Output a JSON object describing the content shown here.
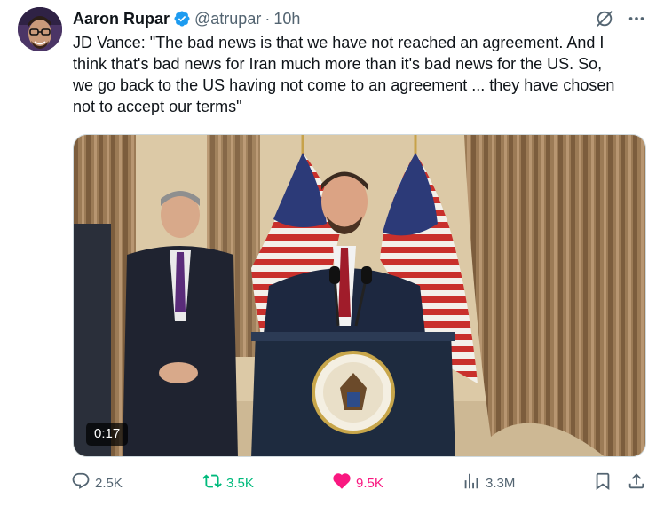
{
  "author": {
    "name": "Aaron Rupar",
    "handle": "@atrupar",
    "separator": "·",
    "time": "10h",
    "verified": true
  },
  "icons": {
    "verified": "verified-badge-icon",
    "grok": "grok-icon",
    "more": "more-options-icon",
    "reply": "reply-icon",
    "repost": "repost-icon",
    "like": "heart-icon",
    "views": "views-icon",
    "bookmark": "bookmark-icon",
    "share": "share-icon"
  },
  "tweet": {
    "text": "JD Vance: \"The bad news is that we have not reached an agreement. And I\nthink that's bad news for Iran much more than it's bad news for the US. So,\nwe go back to the US having not come to an agreement ... they have chosen\nnot to accept our terms\""
  },
  "media": {
    "type": "video",
    "duration": "0:17"
  },
  "actions": {
    "reply_count": "2.5K",
    "repost_count": "3.5K",
    "like_count": "9.5K",
    "views_count": "3.3M",
    "reposted": true,
    "liked": true
  },
  "colors": {
    "text_primary": "#0f1419",
    "text_secondary": "#536471",
    "verified_blue": "#1d9bf0",
    "repost_green": "#00ba7c",
    "like_pink": "#f91880"
  }
}
